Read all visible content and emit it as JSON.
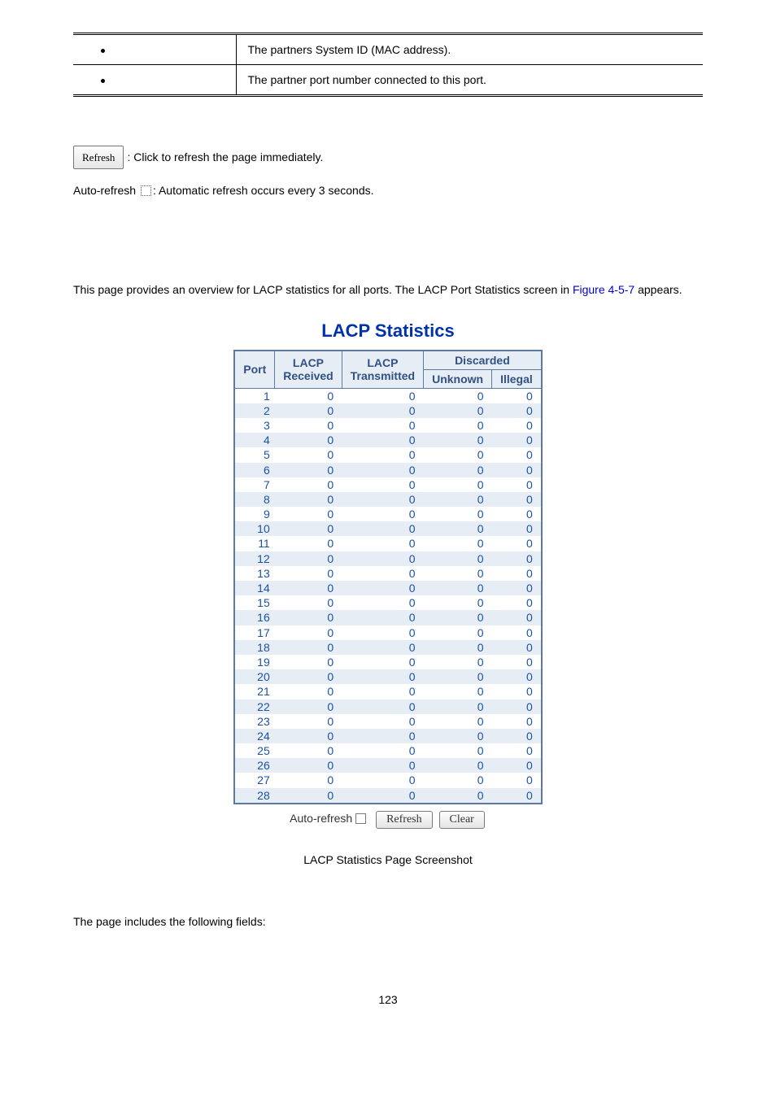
{
  "top_table": {
    "rows": [
      {
        "desc": "The partners System ID (MAC address)."
      },
      {
        "desc": "The partner port number connected to this port."
      }
    ]
  },
  "refresh_btn_label": "Refresh",
  "refresh_note": ": Click to refresh the page immediately.",
  "autorefresh_prefix": "Auto-refresh ",
  "autorefresh_note": ": Automatic refresh occurs every 3 seconds.",
  "intro_text_before": "This page provides an overview for LACP statistics for all ports. The LACP Port Statistics screen in ",
  "intro_figref": "Figure 4-5-7",
  "intro_text_after": " appears.",
  "chart_data": {
    "type": "table",
    "title": "LACP Statistics",
    "columns": [
      "Port",
      "LACP Received",
      "LACP Transmitted",
      "Discarded Unknown",
      "Discarded Illegal"
    ],
    "header_group_discarded": "Discarded",
    "header_port": "Port",
    "header_lacp_rx": "LACP Received",
    "header_lacp_tx": "LACP Transmitted",
    "header_unknown": "Unknown",
    "header_illegal": "Illegal",
    "rows": [
      {
        "port": 1,
        "rx": 0,
        "tx": 0,
        "unk": 0,
        "ill": 0
      },
      {
        "port": 2,
        "rx": 0,
        "tx": 0,
        "unk": 0,
        "ill": 0
      },
      {
        "port": 3,
        "rx": 0,
        "tx": 0,
        "unk": 0,
        "ill": 0
      },
      {
        "port": 4,
        "rx": 0,
        "tx": 0,
        "unk": 0,
        "ill": 0
      },
      {
        "port": 5,
        "rx": 0,
        "tx": 0,
        "unk": 0,
        "ill": 0
      },
      {
        "port": 6,
        "rx": 0,
        "tx": 0,
        "unk": 0,
        "ill": 0
      },
      {
        "port": 7,
        "rx": 0,
        "tx": 0,
        "unk": 0,
        "ill": 0
      },
      {
        "port": 8,
        "rx": 0,
        "tx": 0,
        "unk": 0,
        "ill": 0
      },
      {
        "port": 9,
        "rx": 0,
        "tx": 0,
        "unk": 0,
        "ill": 0
      },
      {
        "port": 10,
        "rx": 0,
        "tx": 0,
        "unk": 0,
        "ill": 0
      },
      {
        "port": 11,
        "rx": 0,
        "tx": 0,
        "unk": 0,
        "ill": 0
      },
      {
        "port": 12,
        "rx": 0,
        "tx": 0,
        "unk": 0,
        "ill": 0
      },
      {
        "port": 13,
        "rx": 0,
        "tx": 0,
        "unk": 0,
        "ill": 0
      },
      {
        "port": 14,
        "rx": 0,
        "tx": 0,
        "unk": 0,
        "ill": 0
      },
      {
        "port": 15,
        "rx": 0,
        "tx": 0,
        "unk": 0,
        "ill": 0
      },
      {
        "port": 16,
        "rx": 0,
        "tx": 0,
        "unk": 0,
        "ill": 0
      },
      {
        "port": 17,
        "rx": 0,
        "tx": 0,
        "unk": 0,
        "ill": 0
      },
      {
        "port": 18,
        "rx": 0,
        "tx": 0,
        "unk": 0,
        "ill": 0
      },
      {
        "port": 19,
        "rx": 0,
        "tx": 0,
        "unk": 0,
        "ill": 0
      },
      {
        "port": 20,
        "rx": 0,
        "tx": 0,
        "unk": 0,
        "ill": 0
      },
      {
        "port": 21,
        "rx": 0,
        "tx": 0,
        "unk": 0,
        "ill": 0
      },
      {
        "port": 22,
        "rx": 0,
        "tx": 0,
        "unk": 0,
        "ill": 0
      },
      {
        "port": 23,
        "rx": 0,
        "tx": 0,
        "unk": 0,
        "ill": 0
      },
      {
        "port": 24,
        "rx": 0,
        "tx": 0,
        "unk": 0,
        "ill": 0
      },
      {
        "port": 25,
        "rx": 0,
        "tx": 0,
        "unk": 0,
        "ill": 0
      },
      {
        "port": 26,
        "rx": 0,
        "tx": 0,
        "unk": 0,
        "ill": 0
      },
      {
        "port": 27,
        "rx": 0,
        "tx": 0,
        "unk": 0,
        "ill": 0
      },
      {
        "port": 28,
        "rx": 0,
        "tx": 0,
        "unk": 0,
        "ill": 0
      }
    ]
  },
  "controls": {
    "autorefresh_label": "Auto-refresh",
    "refresh_label": "Refresh",
    "clear_label": "Clear"
  },
  "caption": "LACP Statistics Page Screenshot",
  "bottom_line": "The page includes the following fields:",
  "page_number": "123"
}
